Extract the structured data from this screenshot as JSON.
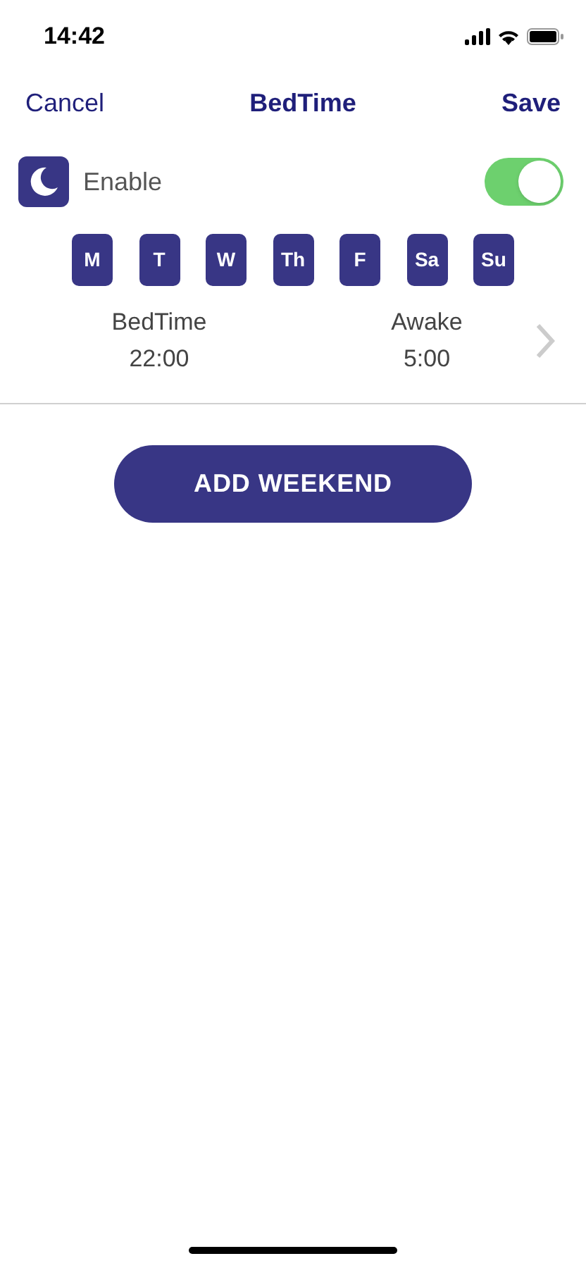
{
  "status_bar": {
    "time": "14:42"
  },
  "nav": {
    "cancel": "Cancel",
    "title": "BedTime",
    "save": "Save"
  },
  "enable": {
    "label": "Enable",
    "on": true
  },
  "days": [
    {
      "label": "M",
      "selected": true
    },
    {
      "label": "T",
      "selected": true
    },
    {
      "label": "W",
      "selected": true
    },
    {
      "label": "Th",
      "selected": true
    },
    {
      "label": "F",
      "selected": true
    },
    {
      "label": "Sa",
      "selected": true
    },
    {
      "label": "Su",
      "selected": true
    }
  ],
  "schedule": {
    "bedtime_label": "BedTime",
    "bedtime": "22:00",
    "awake_label": "Awake",
    "awake": "5:00"
  },
  "add_button": "ADD WEEKEND"
}
